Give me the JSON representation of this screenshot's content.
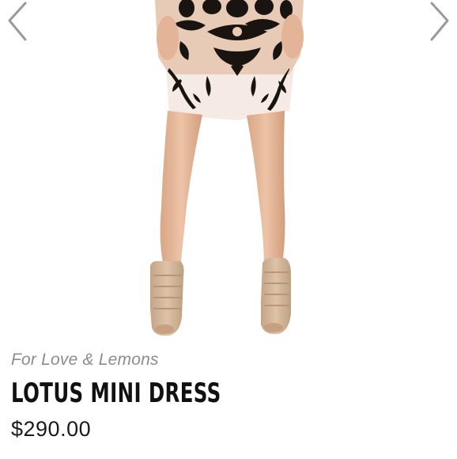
{
  "product": {
    "brand": "For Love & Lemons",
    "title": "LOTUS MINI DRESS",
    "price": "$290.00"
  },
  "carousel": {
    "prev_icon": "chevron-left-icon",
    "next_icon": "chevron-right-icon"
  },
  "colors": {
    "dress_lining": "#e8cbb6",
    "embroidery": "#1a1410",
    "skin": "#e3b497",
    "shoe": "#d2b69a",
    "arrow": "#9a9a9a",
    "brand_text": "#8c8c8c",
    "title_text": "#111111"
  }
}
